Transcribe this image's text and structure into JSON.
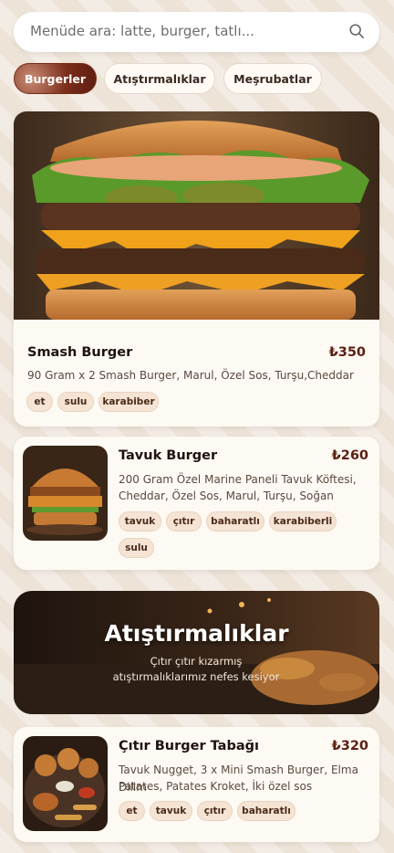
{
  "search": {
    "placeholder": "Menüde ara: latte, burger, tatlı..."
  },
  "categories": [
    {
      "label": "Burgerler",
      "active": true
    },
    {
      "label": "Atıştırmalıklar",
      "active": false
    },
    {
      "label": "Meşrubatlar",
      "active": false
    }
  ],
  "items": [
    {
      "title": "Smash Burger",
      "price": "₺350",
      "desc": "90 Gram x 2 Smash Burger, Marul, Özel Sos, Turşu,Cheddar",
      "tags": [
        "et",
        "sulu",
        "karabiber"
      ]
    },
    {
      "title": "Tavuk Burger",
      "price": "₺260",
      "desc_lines": [
        "200 Gram Özel Marine Paneli Tavuk Köftesi,",
        "Cheddar, Özel Sos, Marul, Turşu, Soğan"
      ],
      "tags": [
        "tavuk",
        "çıtır",
        "baharatlı",
        "karabiberli",
        "sulu"
      ]
    },
    {
      "title": "Çıtır Burger Tabağı",
      "price": "₺320",
      "desc_lines": [
        "Tavuk Nugget, 3 x Mini Smash Burger, Elma Dilim",
        "Patates, Patates Kroket, İki özel sos"
      ],
      "tags": [
        "et",
        "tavuk",
        "çıtır",
        "baharatlı"
      ]
    }
  ],
  "banner": {
    "title": "Atıştırmalıklar",
    "subtitle_lines": [
      "Çıtır çıtır kızarmış",
      "atıştırmalıklarımız nefes kesiyor"
    ]
  }
}
